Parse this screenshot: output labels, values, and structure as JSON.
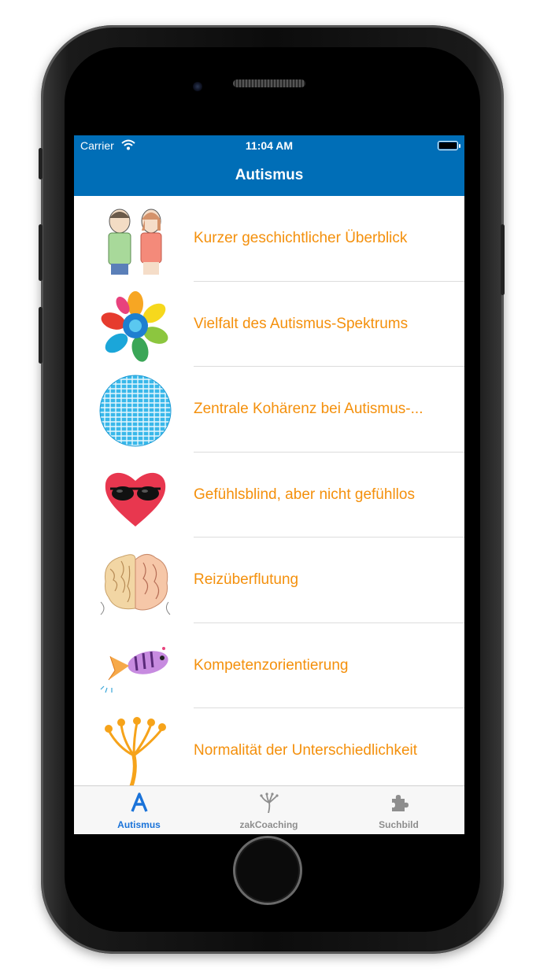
{
  "status_bar": {
    "carrier": "Carrier",
    "time": "11:04 AM"
  },
  "navbar": {
    "title": "Autismus"
  },
  "list": {
    "items": [
      {
        "label": "Kurzer geschichtlicher Überblick",
        "icon": "children-drawing-icon"
      },
      {
        "label": "Vielfalt des Autismus-Spektrums",
        "icon": "colorful-flower-icon"
      },
      {
        "label": "Zentrale Kohärenz bei Autismus-...",
        "icon": "mosaic-sphere-icon"
      },
      {
        "label": "Gefühlsblind, aber nicht gefühllos",
        "icon": "heart-sunglasses-icon"
      },
      {
        "label": "Reizüberflutung",
        "icon": "brain-icon"
      },
      {
        "label": "Kompetenzorientierung",
        "icon": "fish-icon"
      },
      {
        "label": "Normalität der Unterschiedlichkeit",
        "icon": "dandelion-icon"
      }
    ]
  },
  "tabbar": {
    "tabs": [
      {
        "label": "Autismus",
        "icon": "letter-a-icon",
        "active": true
      },
      {
        "label": "zakCoaching",
        "icon": "dandelion-icon",
        "active": false
      },
      {
        "label": "Suchbild",
        "icon": "puzzle-icon",
        "active": false
      }
    ]
  },
  "colors": {
    "navbar": "#006eb7",
    "item_text": "#f4900c",
    "tab_active": "#1a73d9",
    "tab_inactive": "#8e8e8e"
  }
}
